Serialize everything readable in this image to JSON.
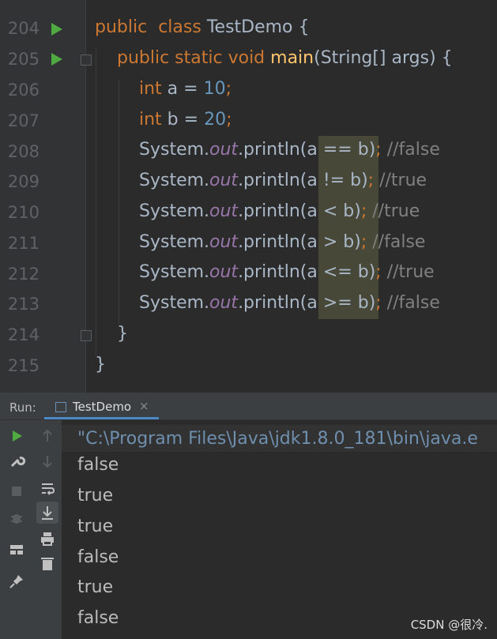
{
  "editor": {
    "lines": [
      {
        "num": "204",
        "run": true,
        "fold": false
      },
      {
        "num": "205",
        "run": true,
        "fold": true
      },
      {
        "num": "206",
        "run": false,
        "fold": false
      },
      {
        "num": "207",
        "run": false,
        "fold": false
      },
      {
        "num": "208",
        "run": false,
        "fold": false
      },
      {
        "num": "209",
        "run": false,
        "fold": false
      },
      {
        "num": "210",
        "run": false,
        "fold": false
      },
      {
        "num": "211",
        "run": false,
        "fold": false
      },
      {
        "num": "212",
        "run": false,
        "fold": false
      },
      {
        "num": "213",
        "run": false,
        "fold": false
      },
      {
        "num": "214",
        "run": false,
        "fold": true
      },
      {
        "num": "215",
        "run": false,
        "fold": false
      }
    ],
    "code": {
      "l204": {
        "kw1": "public",
        "kw2": "class",
        "name": "TestDemo",
        "brace": "{"
      },
      "l205": {
        "kw": "public static void",
        "fn": "main",
        "rest": "(String[] args) {"
      },
      "l206": {
        "kw": "int",
        "mid": " a = ",
        "num": "10",
        "semi": ";"
      },
      "l207": {
        "kw": "int",
        "mid": " b = ",
        "num": "20",
        "semi": ";"
      },
      "prints": [
        {
          "pre": "System.",
          "fld": "out",
          "call": ".println(",
          "expr": "a == b",
          "close": ")",
          "semi": ";",
          "cmt": " //false"
        },
        {
          "pre": "System.",
          "fld": "out",
          "call": ".println(",
          "expr": "a != b",
          "close": ")",
          "semi": ";",
          "cmt": " //true"
        },
        {
          "pre": "System.",
          "fld": "out",
          "call": ".println(",
          "expr": "a < b",
          "close": ")",
          "semi": ";",
          "cmt": " //true"
        },
        {
          "pre": "System.",
          "fld": "out",
          "call": ".println(",
          "expr": "a > b",
          "close": ")",
          "semi": ";",
          "cmt": " //false"
        },
        {
          "pre": "System.",
          "fld": "out",
          "call": ".println(",
          "expr": "a <= b",
          "close": ")",
          "semi": ";",
          "cmt": " //true"
        },
        {
          "pre": "System.",
          "fld": "out",
          "call": ".println(",
          "expr": "a >= b",
          "close": ")",
          "semi": ";",
          "cmt": " //false"
        }
      ],
      "l214": "}",
      "l215": "}"
    }
  },
  "run_panel": {
    "label": "Run:",
    "tab_label": "TestDemo",
    "tab_close": "×",
    "command": "\"C:\\Program Files\\Java\\jdk1.8.0_181\\bin\\java.e",
    "output": [
      "false",
      "true",
      "true",
      "false",
      "true",
      "false"
    ]
  },
  "toolbar_icons": {
    "left": [
      "run-icon",
      "wrench-icon",
      "stop-icon",
      "debug-bug-icon",
      "layout-icon",
      "pin-icon"
    ],
    "right": [
      "up-arrow-icon",
      "down-arrow-icon",
      "soft-wrap-icon",
      "scroll-to-end-icon",
      "print-icon",
      "trash-icon"
    ]
  },
  "watermark": "CSDN @很冷.",
  "colors": {
    "keyword": "#cc7832",
    "method": "#ffc66d",
    "number": "#6897bb",
    "field": "#9876aa",
    "comment": "#808080",
    "run_green": "#4fab41",
    "tab_accent": "#4a88c7"
  }
}
